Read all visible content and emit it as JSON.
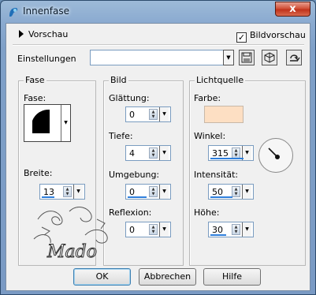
{
  "window": {
    "title": "Innenfase",
    "close_label": "x"
  },
  "header": {
    "preview_toggle_label": "Vorschau",
    "preview_checkbox_label": "Bildvorschau",
    "preview_checked": true,
    "settings_label": "Einstellungen",
    "settings_value": ""
  },
  "fase_group": {
    "title": "Fase",
    "fase_label": "Fase:",
    "breite_label": "Breite:",
    "breite_value": "13"
  },
  "bild_group": {
    "title": "Bild",
    "glaettung_label": "Glättung:",
    "glaettung_value": "0",
    "tiefe_label": "Tiefe:",
    "tiefe_value": "4",
    "umgebung_label": "Umgebung:",
    "umgebung_value": "0",
    "reflexion_label": "Reflexion:",
    "reflexion_value": "0"
  },
  "licht_group": {
    "title": "Lichtquelle",
    "farbe_label": "Farbe:",
    "farbe_color": "#fddfc3",
    "winkel_label": "Winkel:",
    "winkel_value": "315",
    "intensitaet_label": "Intensität:",
    "intensitaet_value": "50",
    "hoehe_label": "Höhe:",
    "hoehe_value": "30"
  },
  "buttons": {
    "ok": "OK",
    "cancel": "Abbrechen",
    "help": "Hilfe"
  },
  "watermark": {
    "text": "Mado"
  }
}
